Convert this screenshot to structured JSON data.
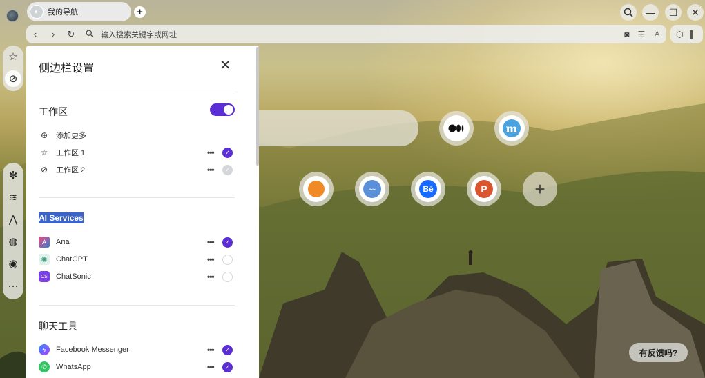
{
  "tab": {
    "title": "我的导航"
  },
  "addressbar": {
    "placeholder": "输入搜索关键字或网址"
  },
  "sidebar_settings": {
    "title": "侧边栏设置",
    "workspace": {
      "title": "工作区",
      "enabled": true,
      "add_more": "添加更多",
      "items": [
        {
          "label": "工作区 1",
          "checked": true
        },
        {
          "label": "工作区 2",
          "checked": false
        }
      ]
    },
    "ai_services": {
      "title": "AI Services",
      "items": [
        {
          "label": "Aria",
          "checked": true
        },
        {
          "label": "ChatGPT",
          "checked": false
        },
        {
          "label": "ChatSonic",
          "checked": false
        }
      ]
    },
    "chat_tools": {
      "title": "聊天工具",
      "items": [
        {
          "label": "Facebook Messenger",
          "checked": true
        },
        {
          "label": "WhatsApp",
          "checked": true
        }
      ]
    }
  },
  "dock": {
    "more_label": "···"
  },
  "feedback": {
    "label": "有反馈吗?"
  },
  "colors": {
    "accent": "#5b2ed6",
    "highlight": "#3b64c8"
  }
}
